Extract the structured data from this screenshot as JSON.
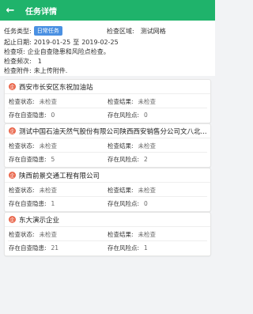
{
  "header": {
    "title": "任务详情",
    "back_icon": "arrow-left-icon"
  },
  "info": {
    "task_type_label": "任务类型:",
    "task_type_value": "日常任务",
    "area_label": "检查区域:",
    "area_value": "测试网格",
    "date_label": "起止日期:",
    "start_date": "2019-01-25",
    "to": "至",
    "end_date": "2019-02-25",
    "item_label": "检查项:",
    "item_value": "企业自查隐患和风险点检查。",
    "count_label": "检查频次:",
    "count_value": "1",
    "attach_label": "检查附件:",
    "attach_value": "未上传附件."
  },
  "labels": {
    "status": "检查状态:",
    "result": "检查结果:",
    "hazards": "存在自查隐患:",
    "risks": "存在风险点:"
  },
  "cards": [
    {
      "icon_text": "企",
      "name": "西安市长安区东祝加油站",
      "status": "未检查",
      "result": "未检查",
      "hazards": "0",
      "risks": "0"
    },
    {
      "icon_text": "企",
      "name": "测试中国石油天然气股份有限公司陕西西安销售分公司文八北...",
      "status": "未检查",
      "result": "未检查",
      "hazards": "5",
      "risks": "2"
    },
    {
      "icon_text": "企",
      "name": "陕西前景交通工程有限公司",
      "status": "未检查",
      "result": "未检查",
      "hazards": "1",
      "risks": "0"
    },
    {
      "icon_text": "企",
      "name": "东大演示企业",
      "status": "未检查",
      "result": "未检查",
      "hazards": "21",
      "risks": "1"
    }
  ]
}
